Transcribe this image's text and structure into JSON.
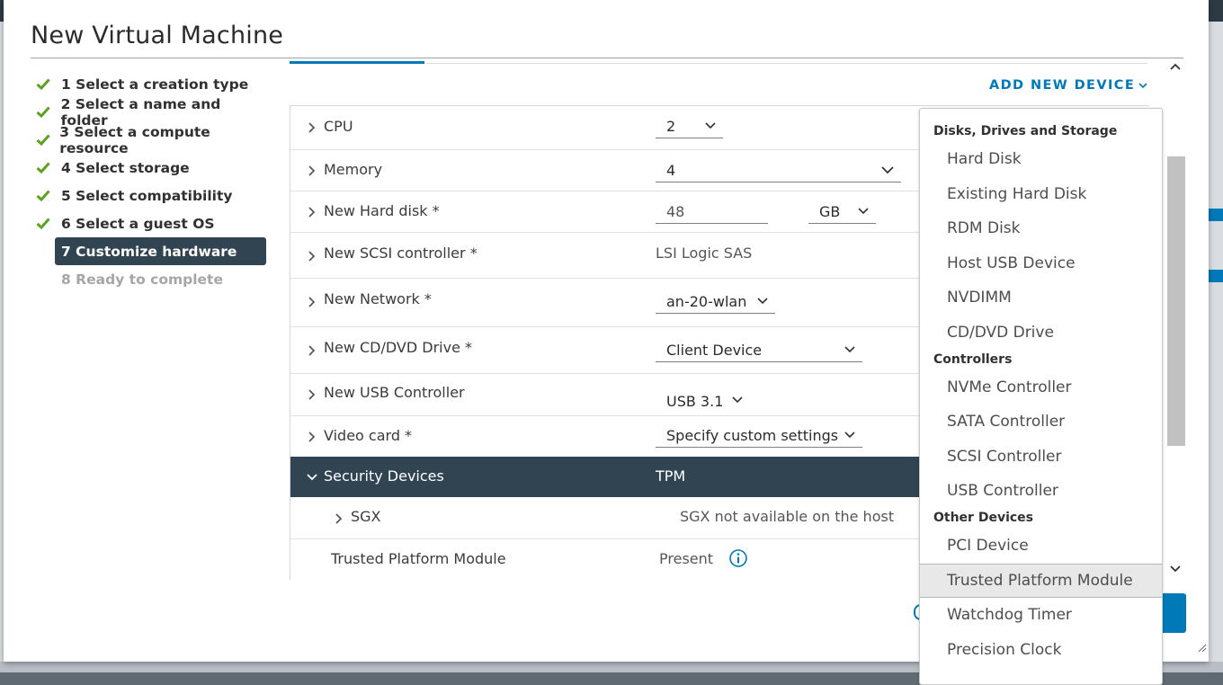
{
  "dialog": {
    "title": "New Virtual Machine"
  },
  "steps": [
    {
      "label": "1 Select a creation type",
      "state": "done"
    },
    {
      "label": "2 Select a name and folder",
      "state": "done"
    },
    {
      "label": "3 Select a compute resource",
      "state": "done"
    },
    {
      "label": "4 Select storage",
      "state": "done"
    },
    {
      "label": "5 Select compatibility",
      "state": "done"
    },
    {
      "label": "6 Select a guest OS",
      "state": "done"
    },
    {
      "label": "7 Customize hardware",
      "state": "active"
    },
    {
      "label": "8 Ready to complete",
      "state": "disabled"
    }
  ],
  "toolbar": {
    "add_device_label": "ADD NEW DEVICE"
  },
  "hardware": {
    "cpu": {
      "label": "CPU",
      "value": "2"
    },
    "memory": {
      "label": "Memory",
      "value": "4"
    },
    "hard_disk": {
      "label": "New Hard disk *",
      "value": "48",
      "unit": "GB"
    },
    "scsi": {
      "label": "New SCSI controller *",
      "value": "LSI Logic SAS"
    },
    "network": {
      "label": "New Network *",
      "value": "an-20-wlan"
    },
    "cd_dvd": {
      "label": "New CD/DVD Drive *",
      "value": "Client Device"
    },
    "usb": {
      "label": "New USB Controller",
      "value": "USB 3.1"
    },
    "video": {
      "label": "Video card *",
      "value": "Specify custom settings"
    },
    "security": {
      "label": "Security Devices",
      "value": "TPM"
    },
    "sgx": {
      "label": "SGX",
      "value": "SGX not available on the host"
    },
    "tpm": {
      "label": "Trusted Platform Module",
      "value": "Present"
    }
  },
  "device_menu": {
    "groups": [
      {
        "header": "Disks, Drives and Storage",
        "items": [
          "Hard Disk",
          "Existing Hard Disk",
          "RDM Disk",
          "Host USB Device",
          "NVDIMM",
          "CD/DVD Drive"
        ]
      },
      {
        "header": "Controllers",
        "items": [
          "NVMe Controller",
          "SATA Controller",
          "SCSI Controller",
          "USB Controller"
        ]
      },
      {
        "header": "Other Devices",
        "items": [
          "PCI Device",
          "Trusted Platform Module",
          "Watchdog Timer",
          "Precision Clock"
        ]
      }
    ],
    "hovered_item": "Trusted Platform Module"
  },
  "colors": {
    "accent": "#0079b8",
    "active_step": "#314452",
    "check": "#5aa220"
  }
}
